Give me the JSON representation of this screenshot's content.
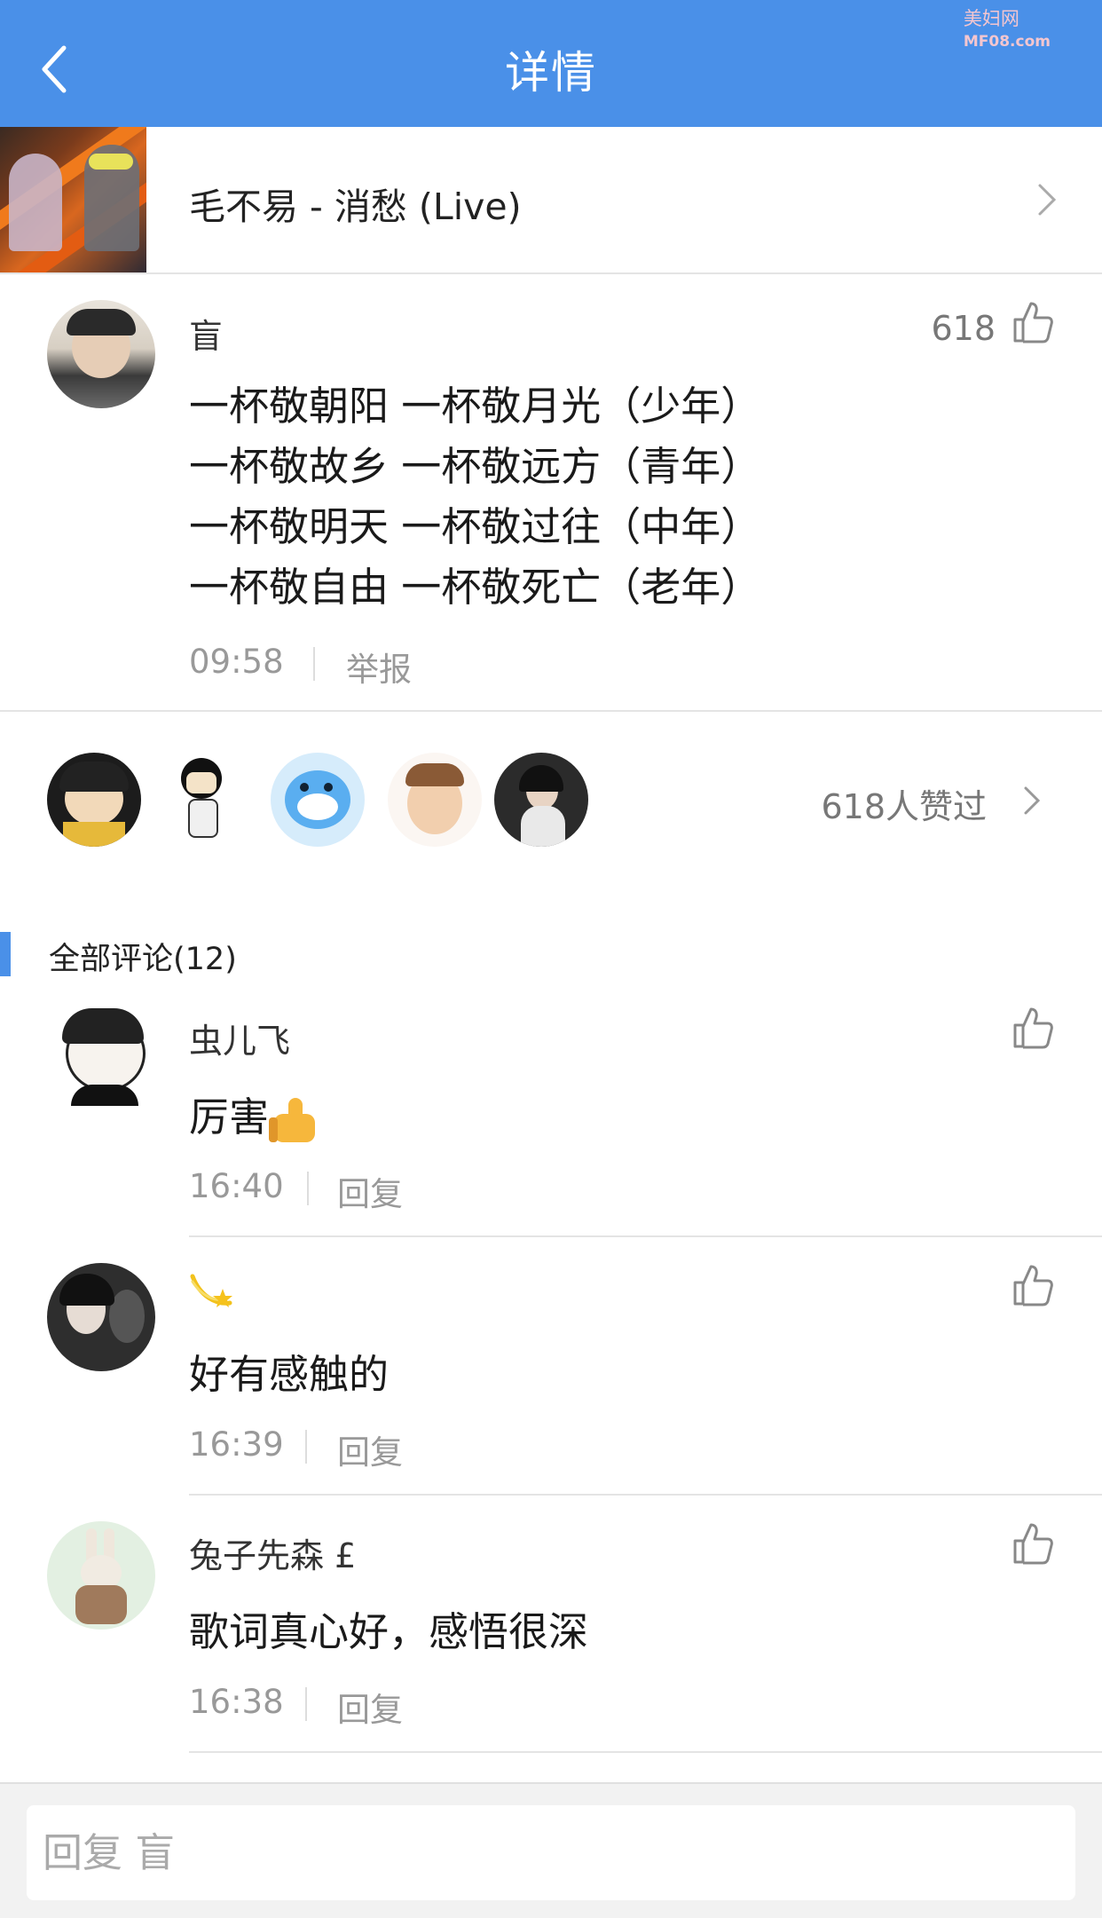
{
  "header": {
    "title": "详情",
    "watermark_cn": "美妇网",
    "watermark_en": "MF08.com"
  },
  "song": {
    "title": "毛不易 - 消愁 (Live)"
  },
  "post": {
    "author": "盲",
    "like_count": "618",
    "lines": [
      "一杯敬朝阳 一杯敬月光（少年）",
      "一杯敬故乡 一杯敬远方（青年）",
      "一杯敬明天 一杯敬过往（中年）",
      "一杯敬自由 一杯敬死亡（老年）"
    ],
    "time": "09:58",
    "report_label": "举报"
  },
  "likers": {
    "summary": "618人赞过"
  },
  "comments_section": {
    "title": "全部评论(12)"
  },
  "comments": [
    {
      "author": "虫儿飞",
      "text": "厉害",
      "time": "16:40",
      "reply_label": "回复"
    },
    {
      "author": "",
      "text": "好有感触的",
      "time": "16:39",
      "reply_label": "回复"
    },
    {
      "author": "兔子先森 £",
      "text": "歌词真心好，感悟很深",
      "time": "16:38",
      "reply_label": "回复"
    }
  ],
  "footer": {
    "reply_placeholder": "回复 盲"
  },
  "colors": {
    "accent": "#4a90e8",
    "divider": "#e4e4e4",
    "secondary_text": "#999999"
  }
}
